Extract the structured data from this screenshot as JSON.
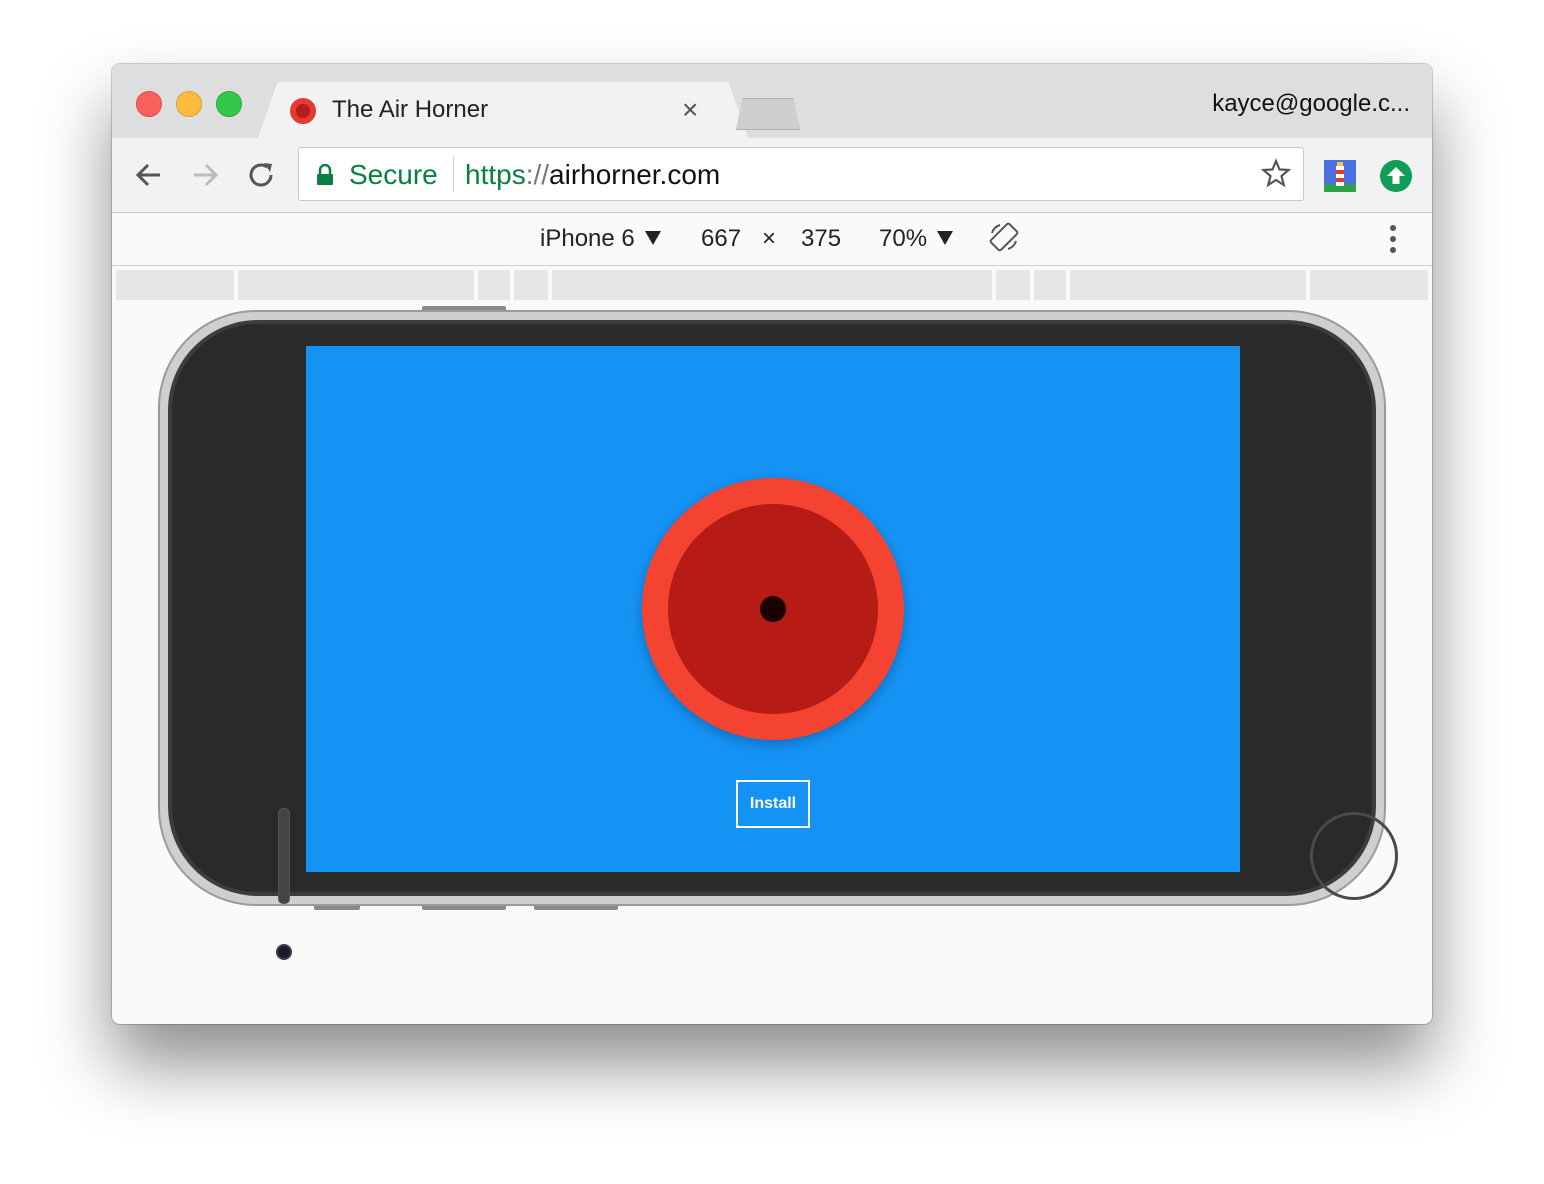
{
  "tab": {
    "title": "The Air Horner",
    "close_label": "×"
  },
  "profile": {
    "label": "kayce@google.c..."
  },
  "omnibox": {
    "security_label": "Secure",
    "url_scheme": "https",
    "url_separator": "://",
    "url_host": "airhorner.com"
  },
  "device_toolbar": {
    "device": "iPhone 6",
    "width": "667",
    "times": "×",
    "height": "375",
    "zoom": "70%"
  },
  "page": {
    "install_label": "Install"
  },
  "colors": {
    "screen_bg": "#1593f5",
    "horn_outer": "#f44331",
    "horn_inner": "#b71b15",
    "secure_green": "#0b8043"
  }
}
